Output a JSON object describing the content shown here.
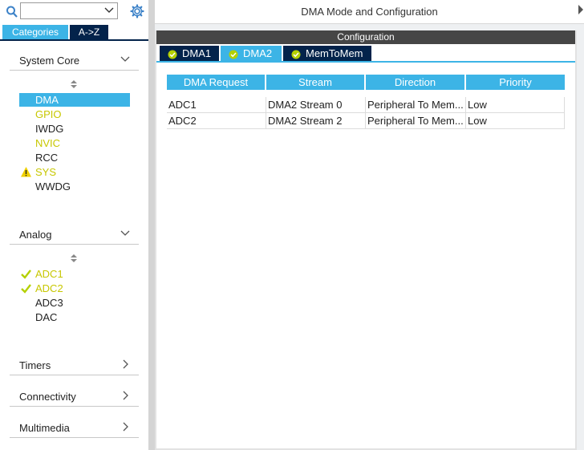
{
  "app": {
    "title": "DMA Mode and Configuration"
  },
  "left": {
    "search": {
      "value": "",
      "placeholder": ""
    },
    "tabs": {
      "categories": "Categories",
      "az": "A->Z"
    },
    "sections": {
      "system_core": {
        "label": "System Core",
        "items": [
          {
            "label": "DMA",
            "state": "selected"
          },
          {
            "label": "GPIO",
            "state": "configured"
          },
          {
            "label": "IWDG",
            "state": "normal"
          },
          {
            "label": "NVIC",
            "state": "configured"
          },
          {
            "label": "RCC",
            "state": "normal"
          },
          {
            "label": "SYS",
            "state": "warning"
          },
          {
            "label": "WWDG",
            "state": "normal"
          }
        ]
      },
      "analog": {
        "label": "Analog",
        "items": [
          {
            "label": "ADC1",
            "state": "enabled"
          },
          {
            "label": "ADC2",
            "state": "enabled"
          },
          {
            "label": "ADC3",
            "state": "normal"
          },
          {
            "label": "DAC",
            "state": "normal"
          }
        ]
      },
      "timers": {
        "label": "Timers"
      },
      "connectivity": {
        "label": "Connectivity"
      },
      "multimedia": {
        "label": "Multimedia"
      }
    }
  },
  "config": {
    "header": "Configuration",
    "tabs": [
      "DMA1",
      "DMA2",
      "MemToMem"
    ],
    "active_tab": "DMA2",
    "table": {
      "columns": [
        "DMA Request",
        "Stream",
        "Direction",
        "Priority"
      ],
      "rows": [
        [
          "ADC1",
          "DMA2 Stream 0",
          "Peripheral To Mem...",
          "Low"
        ],
        [
          "ADC2",
          "DMA2 Stream 2",
          "Peripheral To Mem...",
          "Low"
        ]
      ]
    }
  },
  "colors": {
    "accent": "#3cb4e6",
    "navy": "#03234b",
    "configured_text": "#c7c700",
    "check_green": "#b4d000",
    "warning": "#f0d000",
    "config_header": "#464646"
  }
}
